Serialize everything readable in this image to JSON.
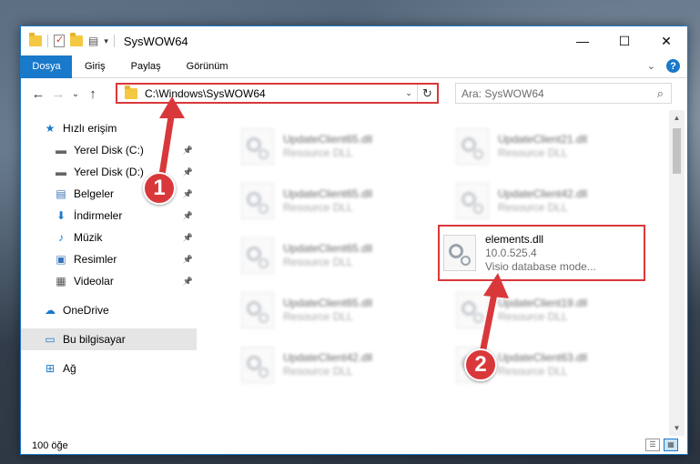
{
  "window": {
    "title": "SysWOW64",
    "controls": {
      "minimize": "—",
      "maximize": "☐",
      "close": "✕"
    }
  },
  "ribbon": {
    "tabs": [
      "Dosya",
      "Giriş",
      "Paylaş",
      "Görünüm"
    ],
    "expand": "⌄",
    "help": "?"
  },
  "nav": {
    "back": "←",
    "forward": "→",
    "recent": "⌄",
    "up": "↑",
    "address": "C:\\Windows\\SysWOW64",
    "address_dropdown": "⌄",
    "refresh": "↻",
    "search_placeholder": "Ara: SysWOW64"
  },
  "sidebar": {
    "items": [
      {
        "label": "Hızlı erişim",
        "icon": "star-icon",
        "pinned": false
      },
      {
        "label": "Yerel Disk (C:)",
        "icon": "drive-icon",
        "pinned": true
      },
      {
        "label": "Yerel Disk (D:)",
        "icon": "drive-icon",
        "pinned": true
      },
      {
        "label": "Belgeler",
        "icon": "documents-icon",
        "pinned": true
      },
      {
        "label": "İndirmeler",
        "icon": "download-icon",
        "pinned": true
      },
      {
        "label": "Müzik",
        "icon": "music-icon",
        "pinned": true
      },
      {
        "label": "Resimler",
        "icon": "pictures-icon",
        "pinned": true
      },
      {
        "label": "Videolar",
        "icon": "videos-icon",
        "pinned": true
      },
      {
        "label": "OneDrive",
        "icon": "cloud-icon",
        "pinned": false
      },
      {
        "label": "Bu bilgisayar",
        "icon": "computer-icon",
        "pinned": false,
        "selected": true
      },
      {
        "label": "Ağ",
        "icon": "network-icon",
        "pinned": false
      }
    ]
  },
  "files": [
    {
      "name": "UpdateClient65.dll",
      "sub": "Resource DLL",
      "blurred": true
    },
    {
      "name": "UpdateClient21.dll",
      "sub": "Resource DLL",
      "blurred": true
    },
    {
      "name": "UpdateClient65.dll",
      "sub": "Resource DLL",
      "blurred": true
    },
    {
      "name": "UpdateClient42.dll",
      "sub": "Resource DLL",
      "blurred": true
    },
    {
      "name": "UpdateClient65.dll",
      "sub": "Resource DLL",
      "blurred": true
    },
    {
      "name": "elements.dll",
      "version": "10.0.525.4",
      "sub": "Visio database mode...",
      "blurred": false,
      "highlight": true
    },
    {
      "name": "UpdateClient65.dll",
      "sub": "Resource DLL",
      "blurred": true
    },
    {
      "name": "UpdateClient19.dll",
      "sub": "Resource DLL",
      "blurred": true
    },
    {
      "name": "UpdateClient42.dll",
      "sub": "Resource DLL",
      "blurred": true
    },
    {
      "name": "UpdateClient63.dll",
      "sub": "Resource DLL",
      "blurred": true
    }
  ],
  "status": {
    "count": "100 öğe"
  },
  "callouts": {
    "one": "1",
    "two": "2"
  },
  "colors": {
    "accent": "#1979ca",
    "highlight": "#d9383b"
  }
}
